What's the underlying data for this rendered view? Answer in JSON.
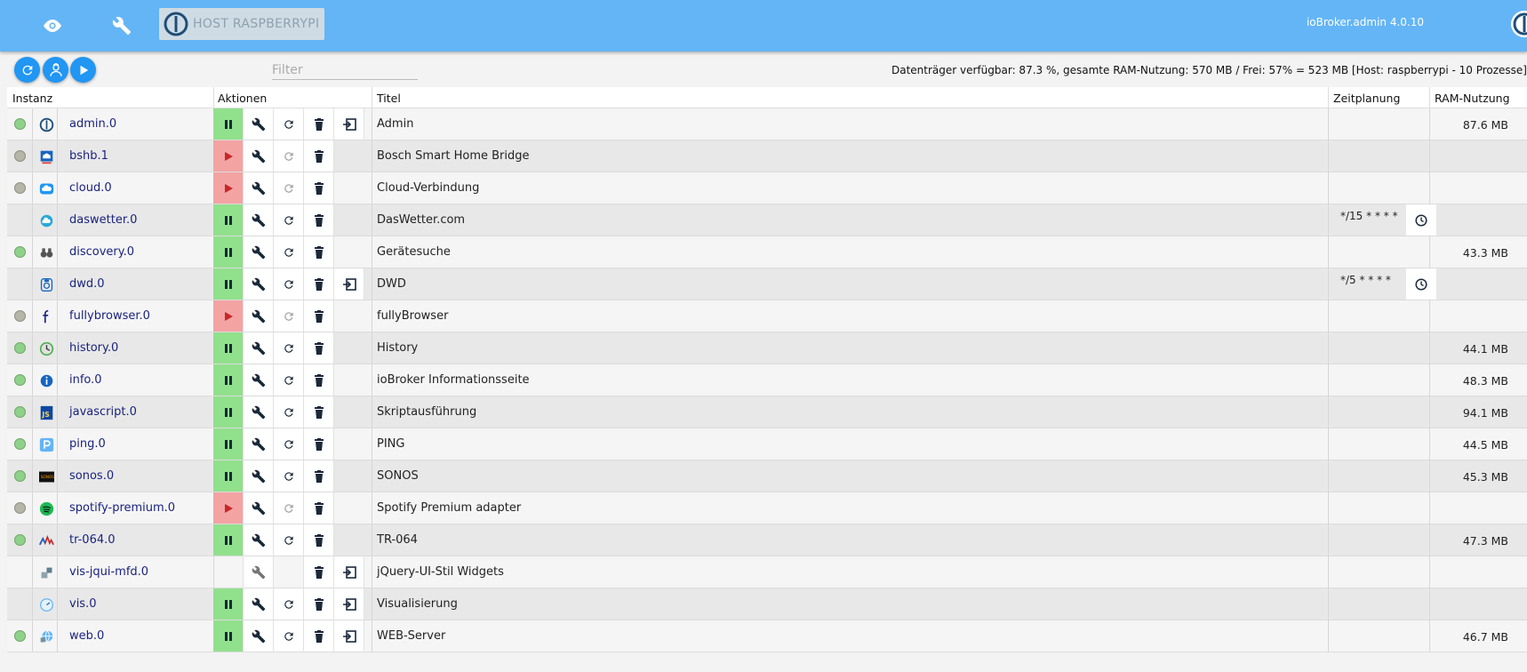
{
  "header": {
    "host_label": "HOST RASPBERRYPI",
    "version": "ioBroker.admin 4.0.10",
    "nav": [
      "eye-icon",
      "wrench-icon"
    ]
  },
  "toolbar": {
    "buttons": [
      "refresh-icon",
      "expert-mode-icon",
      "start-icon"
    ],
    "filter_placeholder": "Filter",
    "sysinfo": "Datenträger verfügbar: 87.3 %, gesamte RAM-Nutzung: 570 MB / Frei: 57% = 523 MB [Host: raspberrypi - 10 Prozesse]"
  },
  "table": {
    "columns": [
      "Instanz",
      "Aktionen",
      "Titel",
      "Zeitplanung",
      "RAM-Nutzung"
    ],
    "rows": [
      {
        "name": "admin.0",
        "title": "Admin",
        "status": "green",
        "state": "running",
        "log": true,
        "sched": "",
        "ram": "87.6 MB",
        "icon": "iobroker-logo-icon"
      },
      {
        "name": "bshb.1",
        "title": "Bosch Smart Home Bridge",
        "status": "grey",
        "state": "stopped",
        "log": false,
        "sched": "",
        "ram": "",
        "icon": "bosch-home-icon"
      },
      {
        "name": "cloud.0",
        "title": "Cloud-Verbindung",
        "status": "grey",
        "state": "stopped",
        "log": false,
        "sched": "",
        "ram": "",
        "icon": "cloud-icon"
      },
      {
        "name": "daswetter.0",
        "title": "DasWetter.com",
        "status": "none",
        "state": "running",
        "log": false,
        "sched": "*/15 * * * *",
        "ram": "",
        "icon": "weather-icon"
      },
      {
        "name": "discovery.0",
        "title": "Gerätesuche",
        "status": "green",
        "state": "running",
        "log": false,
        "sched": "",
        "ram": "43.3 MB",
        "icon": "binoculars-icon"
      },
      {
        "name": "dwd.0",
        "title": "DWD",
        "status": "none",
        "state": "running",
        "log": true,
        "sched": "*/5 * * * *",
        "ram": "",
        "icon": "dwd-icon"
      },
      {
        "name": "fullybrowser.0",
        "title": "fullyBrowser",
        "status": "grey",
        "state": "stopped",
        "log": false,
        "sched": "",
        "ram": "",
        "icon": "fully-f-icon"
      },
      {
        "name": "history.0",
        "title": "History",
        "status": "green",
        "state": "running",
        "log": false,
        "sched": "",
        "ram": "44.1 MB",
        "icon": "history-clock-icon"
      },
      {
        "name": "info.0",
        "title": "ioBroker Informationsseite",
        "status": "green",
        "state": "running",
        "log": false,
        "sched": "",
        "ram": "48.3 MB",
        "icon": "info-icon"
      },
      {
        "name": "javascript.0",
        "title": "Skriptausführung",
        "status": "green",
        "state": "running",
        "log": false,
        "sched": "",
        "ram": "94.1 MB",
        "icon": "javascript-icon"
      },
      {
        "name": "ping.0",
        "title": "PING",
        "status": "green",
        "state": "running",
        "log": false,
        "sched": "",
        "ram": "44.5 MB",
        "icon": "ping-p-icon"
      },
      {
        "name": "sonos.0",
        "title": "SONOS",
        "status": "green",
        "state": "running",
        "log": false,
        "sched": "",
        "ram": "45.3 MB",
        "icon": "sonos-icon"
      },
      {
        "name": "spotify-premium.0",
        "title": "Spotify Premium adapter",
        "status": "grey",
        "state": "stopped",
        "log": false,
        "sched": "",
        "ram": "",
        "icon": "spotify-icon"
      },
      {
        "name": "tr-064.0",
        "title": "TR-064",
        "status": "green",
        "state": "running",
        "log": false,
        "sched": "",
        "ram": "47.3 MB",
        "icon": "avm-icon"
      },
      {
        "name": "vis-jqui-mfd.0",
        "title": "jQuery-UI-Stil Widgets",
        "status": "none",
        "state": "none",
        "log": true,
        "sched": "",
        "ram": "",
        "icon": "widgets-icon"
      },
      {
        "name": "vis.0",
        "title": "Visualisierung",
        "status": "none",
        "state": "running",
        "log": true,
        "sched": "",
        "ram": "",
        "icon": "gauge-icon"
      },
      {
        "name": "web.0",
        "title": "WEB-Server",
        "status": "green",
        "state": "running",
        "log": true,
        "sched": "",
        "ram": "46.7 MB",
        "icon": "web-globe-icon"
      }
    ]
  },
  "colors": {
    "topbar": "#64b5f6",
    "accent": "#2196f3",
    "running": "#91e08c",
    "stopped": "#f4a3a3",
    "status_green": "#8fd18a",
    "status_grey": "#b5b5a8",
    "link": "#1a237e"
  }
}
